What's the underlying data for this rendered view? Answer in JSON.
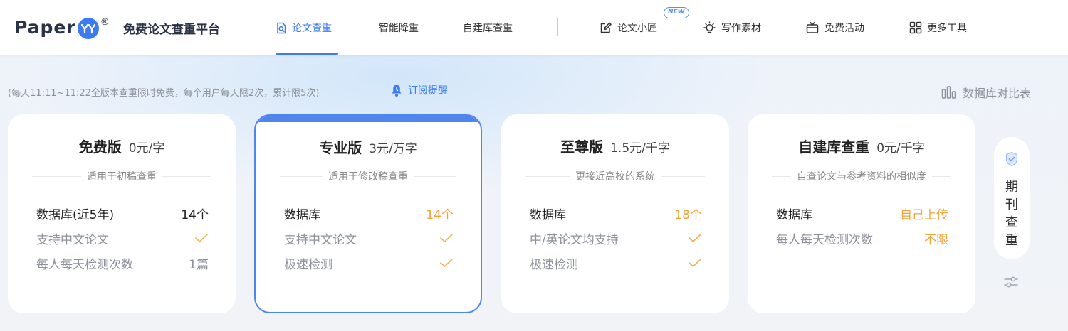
{
  "header": {
    "logo_text": "Paper",
    "logo_reg": "®",
    "platform_name": "免费论文查重平台",
    "nav": {
      "check": "论文查重",
      "reduce": "智能降重",
      "custom": "自建库查重",
      "writer": "论文小匠",
      "writer_badge": "NEW",
      "material": "写作素材",
      "activity": "免费活动",
      "tools": "更多工具"
    },
    "active_nav": "论文查重"
  },
  "notice": "(每天11:11~11:22全版本查重限时免费，每个用户每天限2次，累计限5次)",
  "subscribe_label": "订阅提醒",
  "compare_label": "数据库对比表",
  "cards": [
    {
      "name": "免费版",
      "price": "0元/字",
      "subtitle": "适用于初稿查重",
      "rows": [
        {
          "label": "数据库(近5年)",
          "value": "14个"
        },
        {
          "label": "支持中文论文",
          "value": "check"
        },
        {
          "label": "每人每天检测次数",
          "value": "1篇"
        }
      ]
    },
    {
      "name": "专业版",
      "price": "3元/万字",
      "subtitle": "适用于修改稿查重",
      "selected": true,
      "rows": [
        {
          "label": "数据库",
          "value": "14个"
        },
        {
          "label": "支持中文论文",
          "value": "check"
        },
        {
          "label": "极速检测",
          "value": "check"
        }
      ]
    },
    {
      "name": "至尊版",
      "price": "1.5元/千字",
      "subtitle": "更接近高校的系统",
      "rows": [
        {
          "label": "数据库",
          "value": "18个"
        },
        {
          "label": "中/英论文均支持",
          "value": "check"
        },
        {
          "label": "极速检测",
          "value": "check"
        }
      ]
    },
    {
      "name": "自建库查重",
      "price": "0元/千字",
      "subtitle": "自查论文与参考资料的相似度",
      "rows": [
        {
          "label": "数据库",
          "value": "自己上传"
        },
        {
          "label": "每人每天检测次数",
          "value": "不限"
        }
      ]
    }
  ],
  "side_widget": {
    "chars": [
      "期",
      "刊",
      "查",
      "重"
    ]
  },
  "colors": {
    "accent": "#3c7cf0",
    "highlight": "#f2a33a",
    "muted": "#8c919a"
  },
  "icons": [
    "logo-yy-icon",
    "search-doc-icon",
    "edit-icon",
    "bulb-icon",
    "gift-icon",
    "grid-icon",
    "bell-icon",
    "bar-chart-icon",
    "check-icon",
    "shield-icon",
    "sliders-icon"
  ]
}
